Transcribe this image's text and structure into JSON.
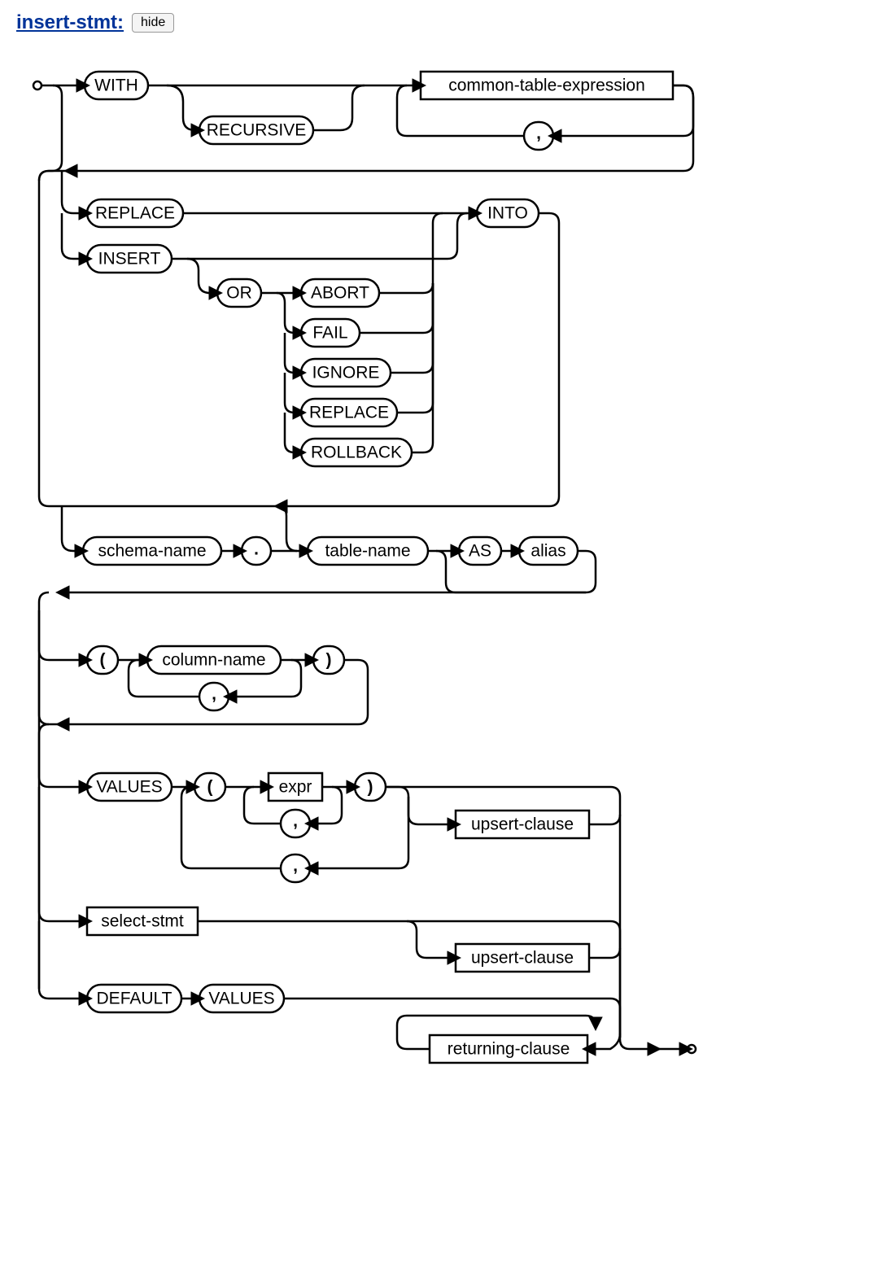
{
  "title": "insert-stmt:",
  "hide_button": "hide",
  "nodes": {
    "with": "WITH",
    "recursive": "RECURSIVE",
    "cte": "common-table-expression",
    "comma_cte": ",",
    "replace": "REPLACE",
    "insert": "INSERT",
    "or": "OR",
    "abort": "ABORT",
    "fail": "FAIL",
    "ignore": "IGNORE",
    "replace2": "REPLACE",
    "rollback": "ROLLBACK",
    "into": "INTO",
    "schema_name": "schema-name",
    "dot": ".",
    "table_name": "table-name",
    "as": "AS",
    "alias": "alias",
    "lparen_cols": "(",
    "column_name": "column-name",
    "comma_cols": ",",
    "rparen_cols": ")",
    "values": "VALUES",
    "lparen_vals": "(",
    "expr": "expr",
    "comma_expr": ",",
    "rparen_vals": ")",
    "comma_row": ",",
    "upsert1": "upsert-clause",
    "select_stmt": "select-stmt",
    "upsert2": "upsert-clause",
    "default": "DEFAULT",
    "values2": "VALUES",
    "returning": "returning-clause"
  }
}
